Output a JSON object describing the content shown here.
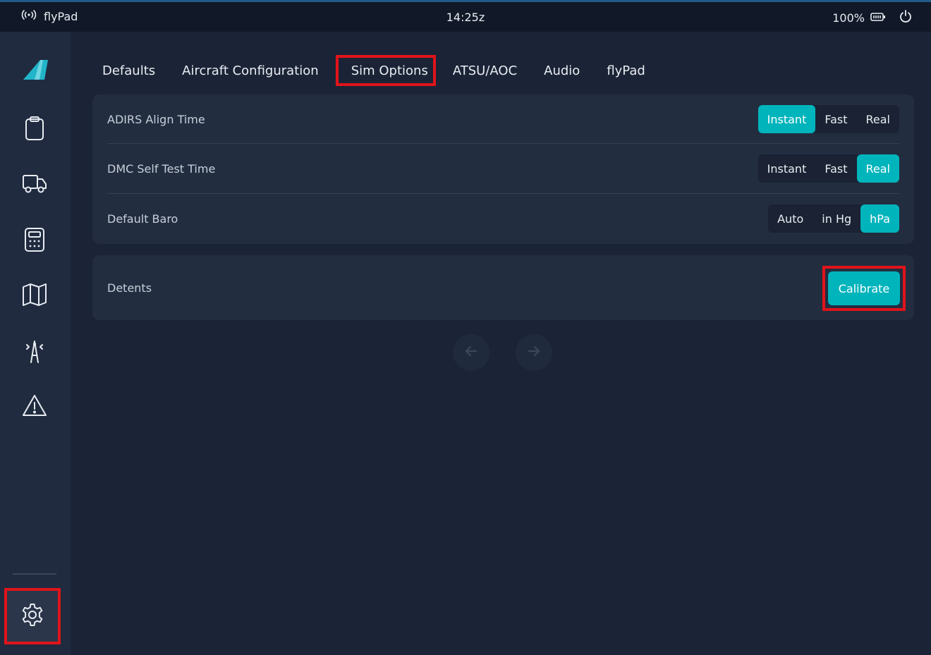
{
  "status_bar": {
    "app_name": "flyPad",
    "time": "14:25z",
    "battery": "100%",
    "icons": [
      "signal-icon",
      "battery-icon",
      "power-icon"
    ]
  },
  "sidebar": {
    "items": [
      {
        "name": "logo-icon"
      },
      {
        "name": "clipboard-icon"
      },
      {
        "name": "truck-icon"
      },
      {
        "name": "calculator-icon"
      },
      {
        "name": "map-icon"
      },
      {
        "name": "tower-icon"
      },
      {
        "name": "warning-icon"
      },
      {
        "name": "gear-icon",
        "selected": true
      }
    ]
  },
  "tabs": [
    {
      "label": "Defaults"
    },
    {
      "label": "Aircraft Configuration"
    },
    {
      "label": "Sim Options",
      "selected": true
    },
    {
      "label": "ATSU/AOC"
    },
    {
      "label": "Audio"
    },
    {
      "label": "flyPad"
    }
  ],
  "settings": {
    "adirs": {
      "label": "ADIRS Align Time",
      "options": [
        "Instant",
        "Fast",
        "Real"
      ],
      "selected": "Instant"
    },
    "dmc": {
      "label": "DMC Self Test Time",
      "options": [
        "Instant",
        "Fast",
        "Real"
      ],
      "selected": "Real"
    },
    "baro": {
      "label": "Default Baro",
      "options": [
        "Auto",
        "in Hg",
        "hPa"
      ],
      "selected": "hPa"
    },
    "detents": {
      "label": "Detents",
      "button": "Calibrate"
    }
  },
  "colors": {
    "accent": "#00b4bc",
    "highlight": "#e0141a",
    "background": "#1b2436",
    "panel": "#222d40"
  }
}
